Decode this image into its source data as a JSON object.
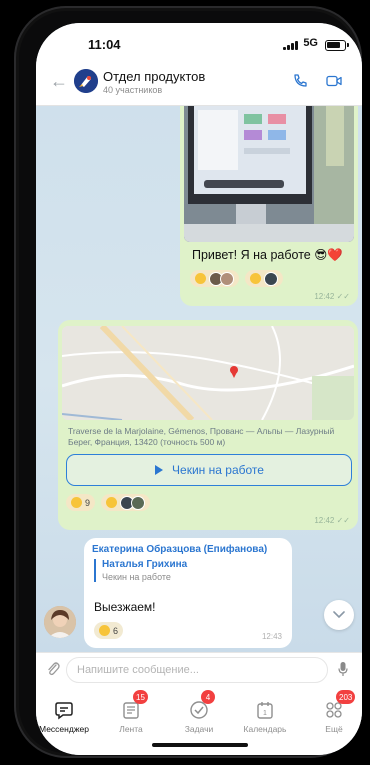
{
  "status": {
    "time": "11:04",
    "network": "5G"
  },
  "header": {
    "title": "Отдел продуктов",
    "subtitle": "40 участников"
  },
  "messages": {
    "photo": {
      "text": "Привет! Я на работе 😎❤️",
      "time": "12:42"
    },
    "location": {
      "address": "Traverse de la Marjolaine, Gémenos, Прованс — Альпы — Лазурный Берег, Франция, 13420 (точность 500 м)",
      "button_label": "Чекин на работе",
      "reaction_count": "9",
      "time": "12:42"
    },
    "reply": {
      "author": "Екатерина Образцова (Епифанова)",
      "quoted_name": "Наталья Грихина",
      "quoted_text": "Чекин на работе",
      "text": "Выезжаем!",
      "reaction_count": "6",
      "time": "12:43"
    }
  },
  "input": {
    "placeholder": "Напишите сообщение..."
  },
  "tabs": [
    {
      "label": "Мессенджер",
      "icon": "chat-icon",
      "badge": ""
    },
    {
      "label": "Лента",
      "icon": "feed-icon",
      "badge": "15"
    },
    {
      "label": "Задачи",
      "icon": "tasks-icon",
      "badge": "4"
    },
    {
      "label": "Календарь",
      "icon": "calendar-icon",
      "badge": ""
    },
    {
      "label": "Ещё",
      "icon": "more-icon",
      "badge": "203"
    }
  ],
  "colors": {
    "accent": "#2b76d0",
    "bubble": "#dff2c9",
    "badge": "#f24040"
  }
}
